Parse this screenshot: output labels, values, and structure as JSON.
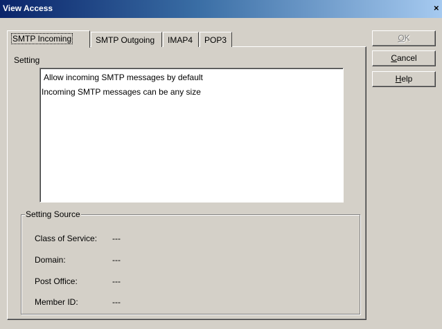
{
  "window": {
    "title": "View Access",
    "close_glyph": "×"
  },
  "tabs": [
    {
      "label": "SMTP Incoming",
      "active": true
    },
    {
      "label": "SMTP Outgoing",
      "active": false
    },
    {
      "label": "IMAP4",
      "active": false
    },
    {
      "label": "POP3",
      "active": false
    }
  ],
  "setting": {
    "label": "Setting",
    "lines": [
      "Allow incoming SMTP messages by default",
      "Incoming SMTP messages can be any size"
    ]
  },
  "source": {
    "title": "Setting Source",
    "rows": [
      {
        "label": "Class of Service:",
        "value": "---"
      },
      {
        "label": "Domain:",
        "value": "---"
      },
      {
        "label": "Post Office:",
        "value": "---"
      },
      {
        "label": "Member ID:",
        "value": "---"
      }
    ]
  },
  "buttons": {
    "ok": {
      "mnemonic": "O",
      "rest": "K",
      "enabled": false
    },
    "cancel": {
      "mnemonic": "C",
      "rest": "ancel",
      "enabled": true
    },
    "help": {
      "mnemonic": "H",
      "rest": "elp",
      "enabled": true
    }
  }
}
